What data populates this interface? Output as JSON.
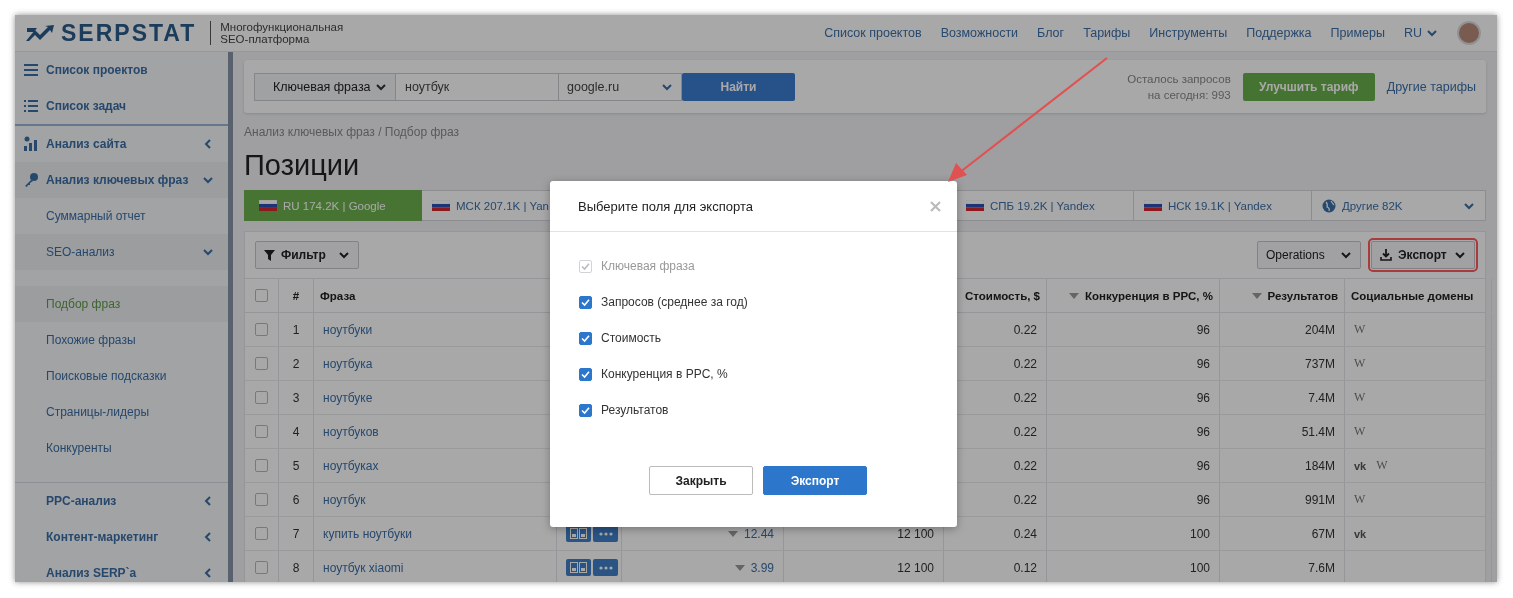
{
  "header": {
    "logo": "SERPSTAT",
    "tagline": [
      "Многофункциональная",
      "SEO-платформа"
    ],
    "nav": [
      "Список проектов",
      "Возможности",
      "Блог",
      "Тарифы",
      "Инструменты",
      "Поддержка",
      "Примеры"
    ],
    "language": "RU"
  },
  "sidebar": {
    "items": [
      {
        "label": "Список проектов"
      },
      {
        "label": "Список задач"
      },
      {
        "label": "Анализ сайта",
        "expanded": false
      },
      {
        "label": "Анализ ключевых фраз",
        "expanded": true,
        "children": [
          {
            "label": "Суммарный отчет"
          },
          {
            "label": "SEO-анализ",
            "expanded": true,
            "children": [
              {
                "label": "Подбор фраз",
                "selected": true
              },
              {
                "label": "Похожие фразы",
                "selected": false
              },
              {
                "label": "Поисковые подсказки",
                "selected": false
              },
              {
                "label": "Страницы-лидеры",
                "selected": false
              },
              {
                "label": "Конкуренты",
                "selected": false
              }
            ]
          }
        ]
      },
      {
        "label": "PPC-анализ",
        "expanded": false
      },
      {
        "label": "Контент-маркетинг",
        "expanded": false
      },
      {
        "label": "Анализ SERP`а",
        "expanded": false
      }
    ]
  },
  "search": {
    "type": "Ключевая фраза",
    "query": "ноутбук",
    "engine": "google.ru",
    "button": "Найти"
  },
  "quota": [
    "Осталось запросов",
    "на сегодня: 993"
  ],
  "upgrade_button": "Улучшить тариф",
  "plans_link": "Другие тарифы",
  "breadcrumb": "Анализ ключевых фраз / Подбор фраз",
  "title": "Позиции",
  "region_tabs": [
    {
      "label": "RU 174.2K | Google",
      "kind": "region",
      "selected": true
    },
    {
      "label": "МСК 207.1K | Yan",
      "kind": "region",
      "selected": false
    },
    {
      "label": "СПБ 19.2K | Yandex",
      "kind": "region",
      "selected": false
    },
    {
      "label": "НСК 19.1K | Yandex",
      "kind": "region",
      "selected": false
    },
    {
      "label": "Другие 82K",
      "kind": "more",
      "selected": false
    }
  ],
  "toolbar": {
    "filter": "Фильтр",
    "operations": "Operations",
    "export": "Экспорт"
  },
  "table": {
    "header_checked": false,
    "columns": [
      {
        "label": "#"
      },
      {
        "label": "Фраза"
      },
      {
        "label": "Стоимость, $",
        "sort": false
      },
      {
        "label": "Конкуренция в PPC, %",
        "sort": true
      },
      {
        "label": "Результатов",
        "sort": true
      },
      {
        "label": "Социальные домены"
      }
    ],
    "rows": [
      {
        "checked": false,
        "num": "1",
        "phrase": "ноутбуки",
        "cost": "0.22",
        "competition": "96",
        "results": "204M",
        "social": [
          {
            "kind": "wiki",
            "text": "W"
          }
        ]
      },
      {
        "checked": false,
        "num": "2",
        "phrase": "ноутбука",
        "cost": "0.22",
        "competition": "96",
        "results": "737M",
        "social": [
          {
            "kind": "wiki",
            "text": "W"
          }
        ]
      },
      {
        "checked": false,
        "num": "3",
        "phrase": "ноутбуке",
        "cost": "0.22",
        "competition": "96",
        "results": "7.4M",
        "social": [
          {
            "kind": "wiki",
            "text": "W"
          }
        ]
      },
      {
        "checked": false,
        "num": "4",
        "phrase": "ноутбуков",
        "cost": "0.22",
        "competition": "96",
        "results": "51.4M",
        "social": [
          {
            "kind": "wiki",
            "text": "W"
          }
        ]
      },
      {
        "checked": false,
        "num": "5",
        "phrase": "ноутбуках",
        "cost": "0.22",
        "competition": "96",
        "results": "184M",
        "social": [
          {
            "kind": "vk",
            "text": "vk"
          },
          {
            "kind": "wiki",
            "text": "W"
          }
        ]
      },
      {
        "checked": false,
        "num": "6",
        "phrase": "ноутбук",
        "cost": "0.22",
        "competition": "96",
        "results": "991M",
        "social": [
          {
            "kind": "wiki",
            "text": "W"
          }
        ]
      },
      {
        "checked": false,
        "num": "7",
        "phrase": "купить ноутбуки",
        "actions": true,
        "column_5": "12.44",
        "column_6": "12 100",
        "cost": "0.24",
        "competition": "100",
        "results": "67M",
        "social": [
          {
            "kind": "vk",
            "text": "vk"
          }
        ]
      },
      {
        "checked": false,
        "num": "8",
        "phrase": "ноутбук xiaomi",
        "actions": true,
        "column_5": "3.99",
        "column_6": "12 100",
        "cost": "0.12",
        "competition": "100",
        "results": "7.6M",
        "social": []
      }
    ]
  },
  "modal": {
    "title": "Выберите поля для экспорта",
    "fields": [
      {
        "label": "Ключевая фраза",
        "checked": true,
        "disabled": true
      },
      {
        "label": "Запросов (среднее за год)",
        "checked": true,
        "disabled": false
      },
      {
        "label": "Стоимость",
        "checked": true,
        "disabled": false
      },
      {
        "label": "Конкуренция в PPC, %",
        "checked": true,
        "disabled": false
      },
      {
        "label": "Результатов",
        "checked": true,
        "disabled": false
      }
    ],
    "buttons": [
      {
        "label": "Закрыть",
        "kind": "secondary"
      },
      {
        "label": "Экспорт",
        "kind": "primary"
      }
    ]
  }
}
